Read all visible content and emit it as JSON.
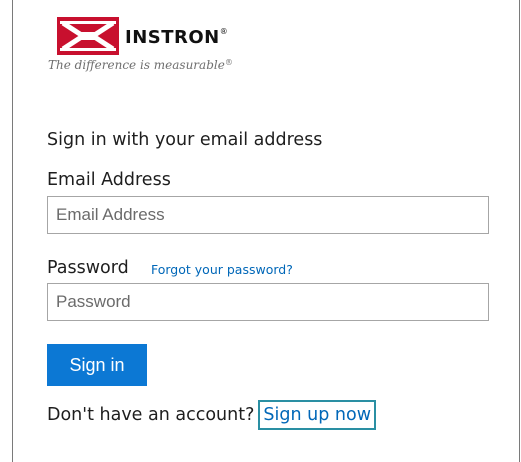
{
  "brand": {
    "logo_icon": "instron-red-logo-icon",
    "name": "INSTRON",
    "trademark": "®",
    "tagline": "The difference is measurable",
    "tagline_mark": "®",
    "brand_color": "#c8102e"
  },
  "form": {
    "heading": "Sign in with your email address",
    "email": {
      "label": "Email Address",
      "placeholder": "Email Address",
      "value": ""
    },
    "password": {
      "label": "Password",
      "forgot_link": "Forgot your password?",
      "placeholder": "Password",
      "value": ""
    },
    "submit_label": "Sign in",
    "submit_color": "#0c78d4"
  },
  "signup": {
    "prompt": "Don't have an account?",
    "link": "Sign up now",
    "focus_outline_color": "#2a8fa3"
  },
  "link_color": "#0067b8"
}
